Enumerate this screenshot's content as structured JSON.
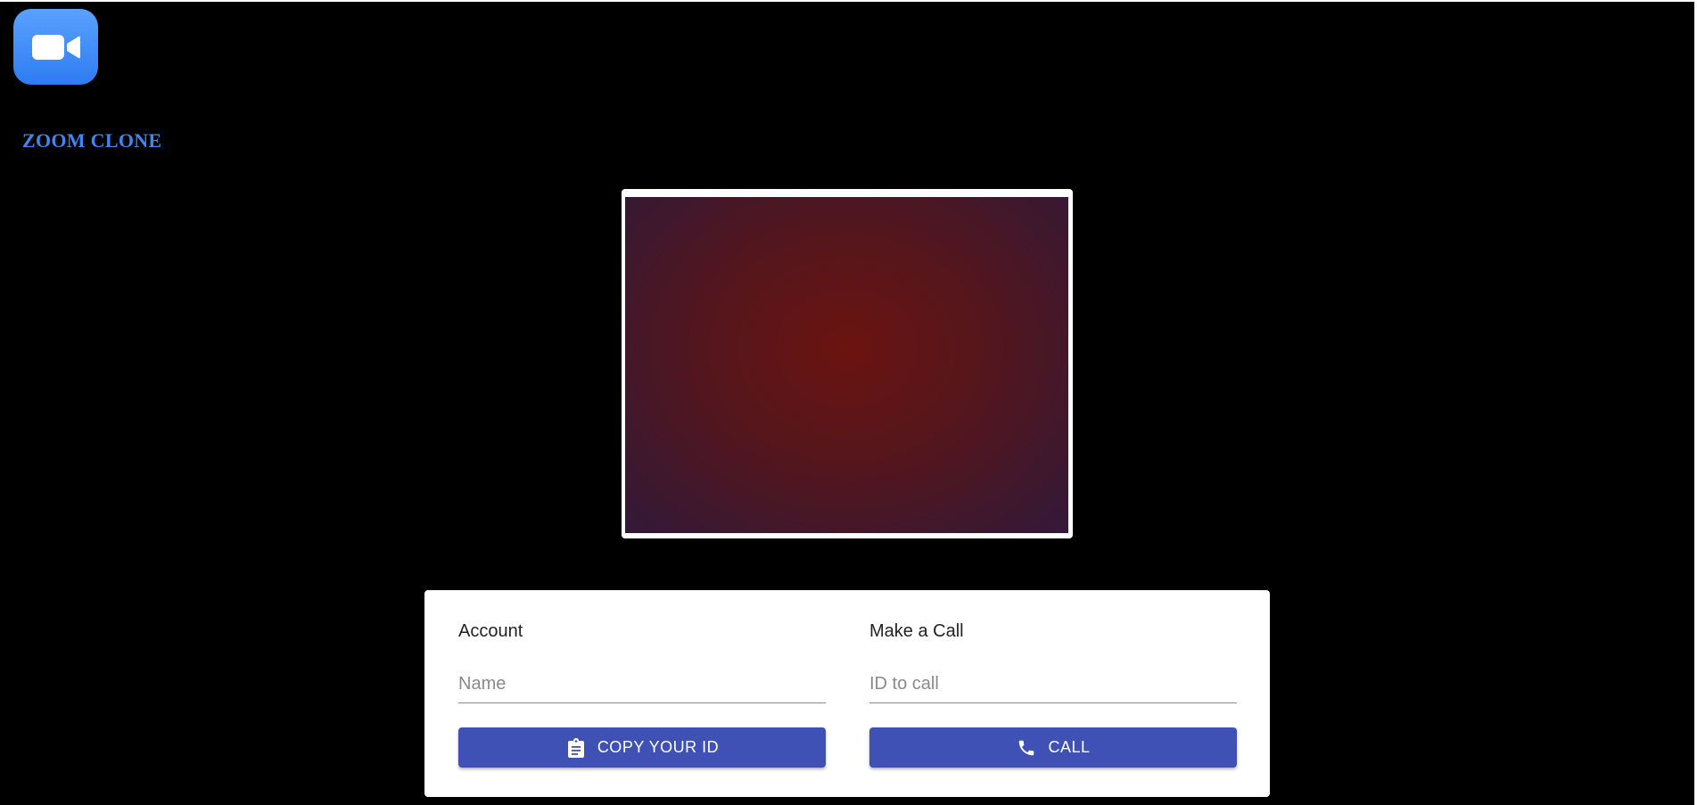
{
  "app": {
    "title": "ZOOM CLONE",
    "logo_icon": "video-camera-icon",
    "logo_color": "#2d8cff"
  },
  "video": {
    "state": "local-camera-preview"
  },
  "account": {
    "title": "Account",
    "name_placeholder": "Name",
    "name_value": "",
    "copy_button_label": "COPY YOUR ID",
    "copy_button_icon": "clipboard-icon"
  },
  "call": {
    "title": "Make a Call",
    "id_placeholder": "ID to call",
    "id_value": "",
    "call_button_label": "CALL",
    "call_button_icon": "phone-icon"
  },
  "colors": {
    "background": "#000000",
    "title": "#3f86f1",
    "button": "#3f51b5",
    "panel": "#ffffff"
  }
}
